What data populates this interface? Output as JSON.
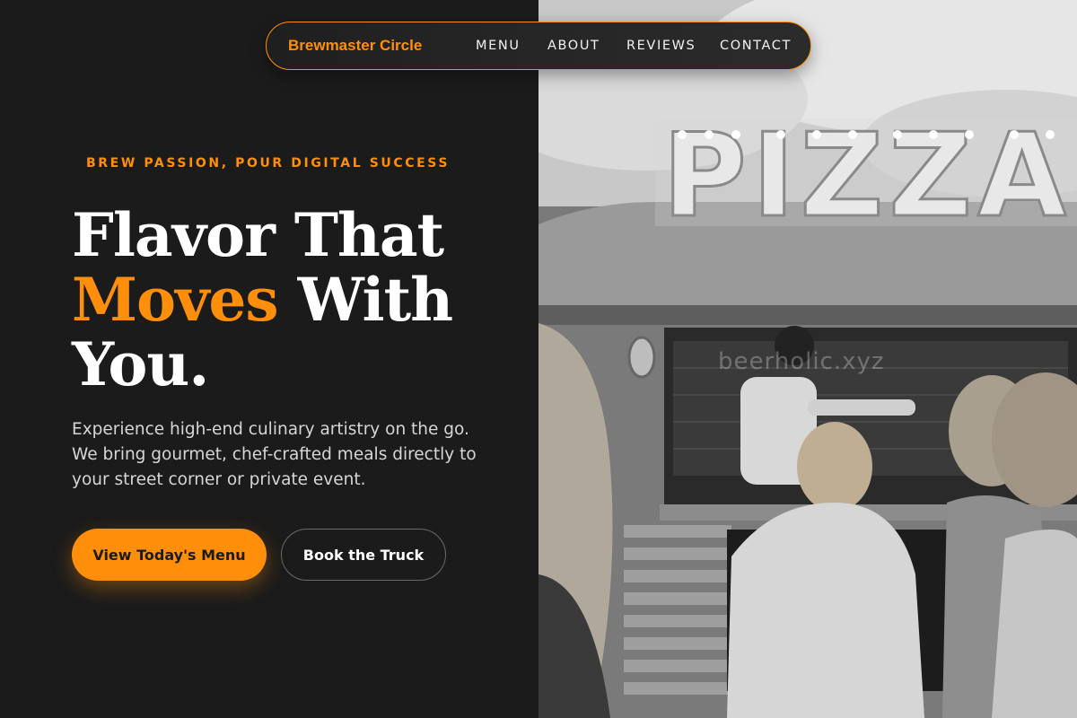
{
  "nav": {
    "brand": "Brewmaster Circle",
    "links": [
      {
        "label": "MENU"
      },
      {
        "label": "ABOUT"
      },
      {
        "label": "REVIEWS"
      },
      {
        "label": "CONTACT"
      }
    ]
  },
  "hero": {
    "kicker": "BREW PASSION, POUR DIGITAL SUCCESS",
    "headline": {
      "line1": "Flavor That",
      "accent": "Moves",
      "line2_rest": "With",
      "line3": "You."
    },
    "description": "Experience high-end culinary artistry on the go. We bring gourmet, chef-crafted meals directly to your street corner or private event.",
    "primary_cta": "View Today's Menu",
    "secondary_cta": "Book the Truck"
  },
  "photo": {
    "sign_text": "PIZZA",
    "watermark": "beerholic.xyz"
  },
  "colors": {
    "accent": "#ff8f0a",
    "background": "#1b1b1b",
    "text": "#ffffff",
    "muted_text": "#d6d6d6"
  }
}
